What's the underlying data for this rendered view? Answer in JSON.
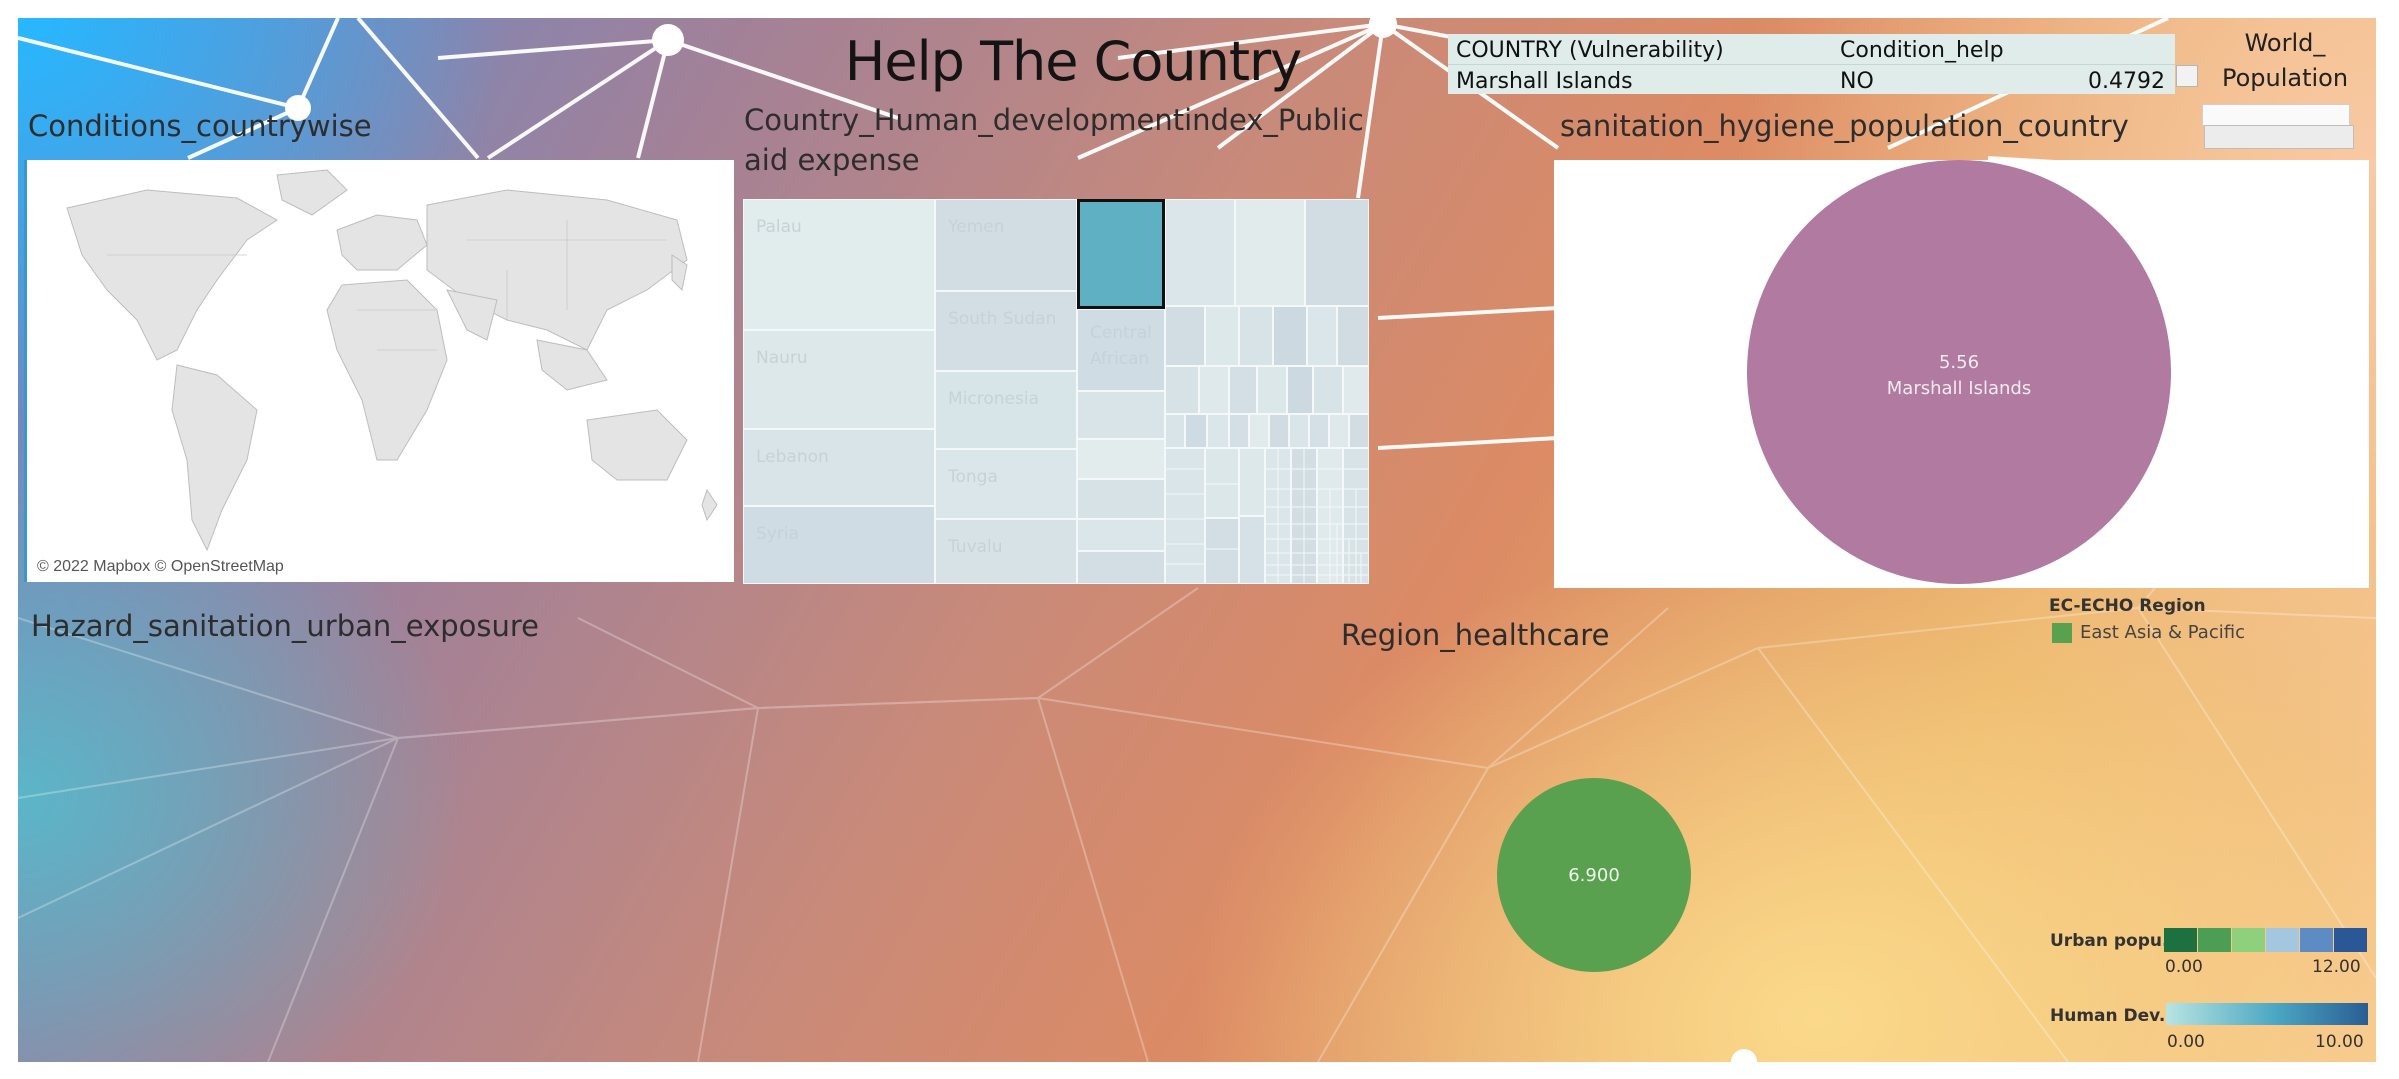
{
  "dashboard": {
    "title": "Help The Country"
  },
  "sections": {
    "conditions_countrywise": "Conditions_countrywise",
    "hdi_title_line1": "Country_Human_developmentindex_Public",
    "hdi_title_line2": "aid expense",
    "sanitation_hygiene": "sanitation_hygiene_population_country",
    "hazard_sanitation": "Hazard_sanitation_urban_exposure",
    "region_healthcare": "Region_healthcare"
  },
  "map": {
    "attribution": "© 2022 Mapbox © OpenStreetMap"
  },
  "treemap": {
    "labels": {
      "palau": "Palau",
      "nauru": "Nauru",
      "lebanon": "Lebanon",
      "syria": "Syria",
      "yemen": "Yemen",
      "south_sudan": "South Sudan",
      "micronesia": "Micronesia",
      "tonga": "Tonga",
      "tuvalu": "Tuvalu",
      "car_line1": "Central",
      "car_line2": "African"
    },
    "highlight_color": "#5fb0c2"
  },
  "vulnerability_table": {
    "header_country": "COUNTRY (Vulnerability)",
    "header_condition": "Condition_help",
    "row_country": "Marshall Islands",
    "row_condition": "NO",
    "row_value": "0.4792"
  },
  "world_population": {
    "label_line1": "World_",
    "label_line2": "Population"
  },
  "chart_data": [
    {
      "type": "pie",
      "title": "sanitation_hygiene_population_country",
      "slices": [
        {
          "label": "Marshall Islands",
          "value": 5.56,
          "display": "5.56",
          "color": "#b07aa1"
        }
      ]
    },
    {
      "type": "scatter",
      "title": "Region_healthcare",
      "points": [
        {
          "label": "East Asia & Pacific",
          "value": 6.9,
          "display": "6.900",
          "color": "#59a14f"
        }
      ]
    }
  ],
  "legends": {
    "region": {
      "title": "EC-ECHO Region",
      "items": [
        {
          "label": "East Asia & Pacific",
          "color": "#59a14f"
        }
      ]
    },
    "urban": {
      "label": "Urban popu..",
      "min": "0.00",
      "max": "12.00",
      "colors": [
        "#1d7040",
        "#4d9e55",
        "#8fd07d",
        "#a3c7de",
        "#5d8cc4",
        "#2a5896"
      ]
    },
    "human_dev": {
      "label": "Human Dev..",
      "min": "0.00",
      "max": "10.00",
      "color_start": "#b8e4e1",
      "color_mid": "#4aa6c2",
      "color_end": "#2a5d93"
    }
  }
}
